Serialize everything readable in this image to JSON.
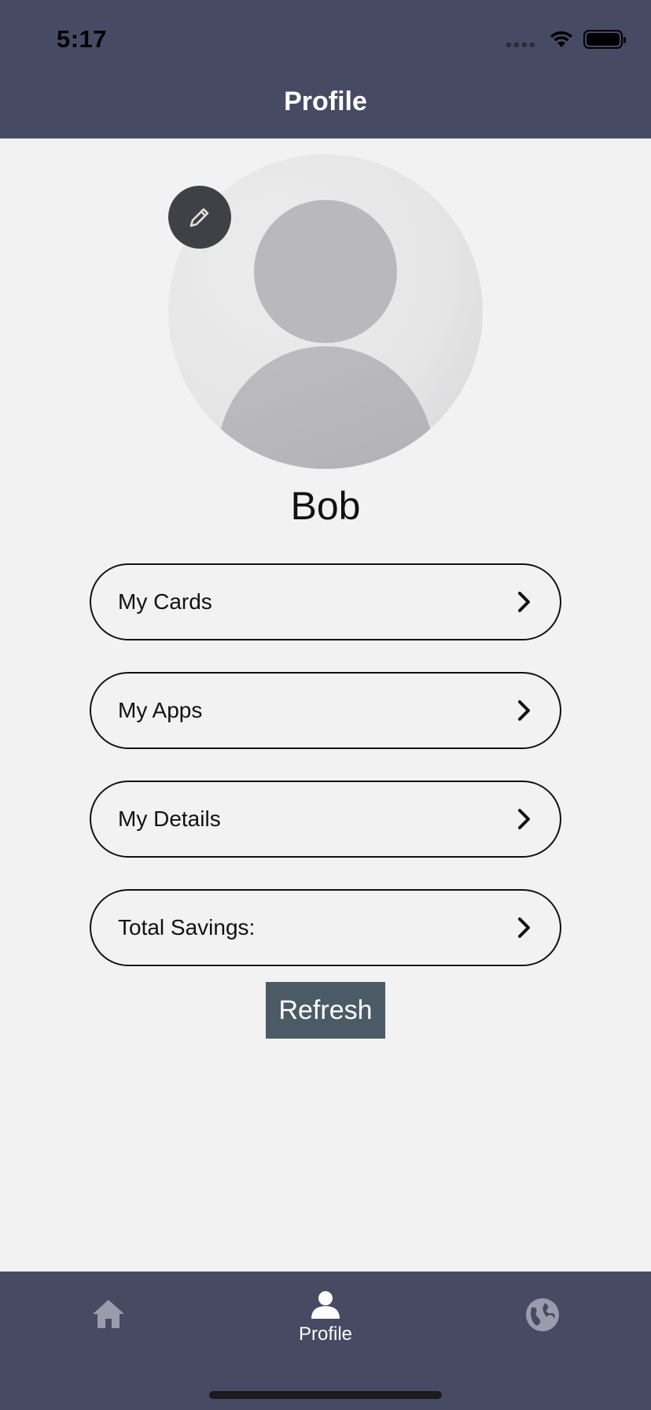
{
  "status_bar": {
    "time": "5:17"
  },
  "header": {
    "title": "Profile"
  },
  "profile": {
    "name": "Bob"
  },
  "menu": [
    {
      "label": "My Cards"
    },
    {
      "label": "My Apps"
    },
    {
      "label": "My Details"
    },
    {
      "label": "Total Savings:"
    }
  ],
  "refresh_label": "Refresh",
  "tabs": [
    {
      "icon": "home-icon",
      "label": ""
    },
    {
      "icon": "person-icon",
      "label": "Profile"
    },
    {
      "icon": "globe-icon",
      "label": ""
    }
  ],
  "colors": {
    "header_bg": "#464a63",
    "page_bg": "#f2f2f2",
    "refresh_bg": "#4b5b66",
    "edit_btn_bg": "#404146",
    "inactive_tab_icon": "#9a9cab"
  }
}
